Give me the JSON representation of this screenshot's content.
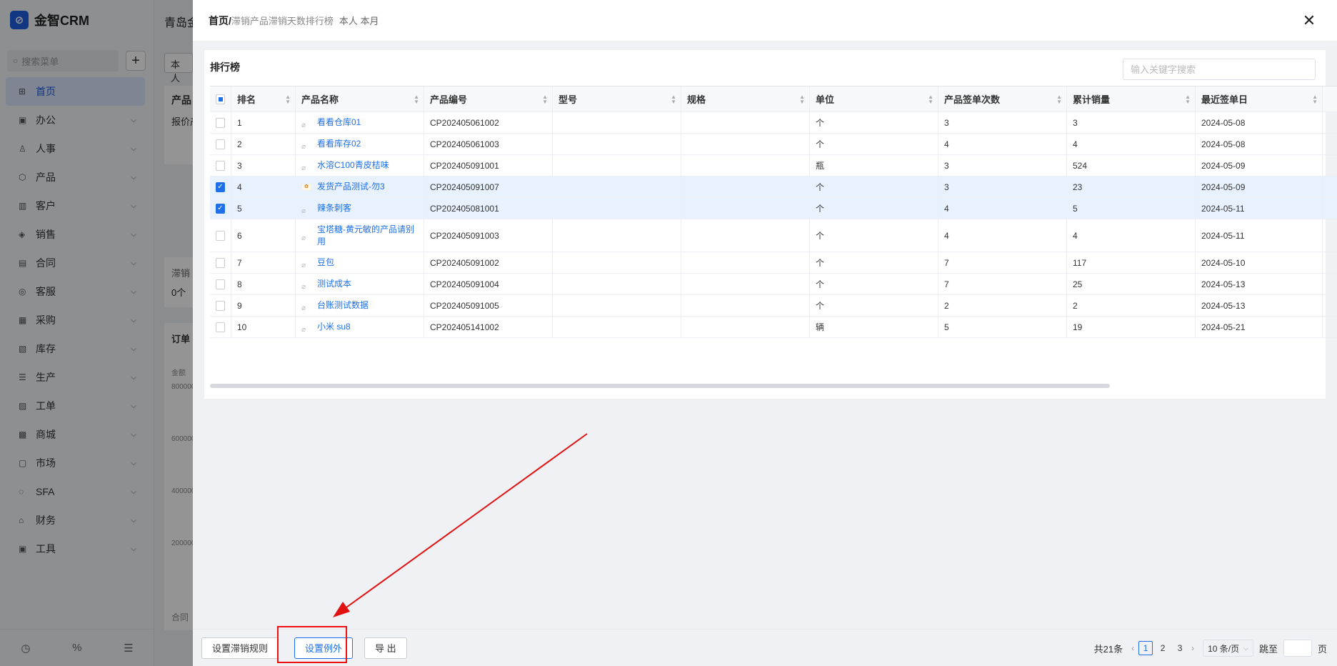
{
  "app": {
    "name": "金智CRM",
    "search_placeholder": "搜索菜单",
    "menu": [
      {
        "label": "首页",
        "icon": "home-icon",
        "active": true
      },
      {
        "label": "办公",
        "icon": "office-icon"
      },
      {
        "label": "人事",
        "icon": "people-icon"
      },
      {
        "label": "产品",
        "icon": "product-icon"
      },
      {
        "label": "客户",
        "icon": "customer-icon"
      },
      {
        "label": "销售",
        "icon": "sales-icon"
      },
      {
        "label": "合同",
        "icon": "contract-icon"
      },
      {
        "label": "客服",
        "icon": "service-icon"
      },
      {
        "label": "采购",
        "icon": "purchase-icon"
      },
      {
        "label": "库存",
        "icon": "inventory-icon"
      },
      {
        "label": "生产",
        "icon": "production-icon"
      },
      {
        "label": "工单",
        "icon": "workorder-icon"
      },
      {
        "label": "商城",
        "icon": "mall-icon"
      },
      {
        "label": "市场",
        "icon": "market-icon"
      },
      {
        "label": "SFA",
        "icon": "sfa-icon"
      },
      {
        "label": "财务",
        "icon": "finance-icon"
      },
      {
        "label": "工具",
        "icon": "tools-icon"
      }
    ],
    "bg_title": "青岛金",
    "bg_chip": "本人",
    "bg_text1": "产品",
    "bg_text2": "报价产",
    "bg_text3": "滞销",
    "bg_text4": "0个",
    "bg_text5": "订单",
    "bg_legend": "金额",
    "bg_ticks": [
      "800000",
      "600000",
      "400000",
      "200000"
    ],
    "bg_bottom": "合同"
  },
  "drawer": {
    "breadcrumb_home": "首页/",
    "breadcrumb_title": "滞销产品滞销天数排行榜",
    "breadcrumb_meta": "本人 本月",
    "panel_title": "排行榜",
    "search_placeholder": "输入关键字搜索",
    "columns": [
      "排名",
      "产品名称",
      "产品编号",
      "型号",
      "规格",
      "单位",
      "产品签单次数",
      "累计销量",
      "最近签单日"
    ],
    "rows": [
      {
        "rank": "1",
        "name": "看看仓库01",
        "code": "CP202405061002",
        "model": "",
        "spec": "",
        "unit": "个",
        "count": "3",
        "sales": "3",
        "date": "2024-05-08",
        "checked": false,
        "img": false
      },
      {
        "rank": "2",
        "name": "看看库存02",
        "code": "CP202405061003",
        "model": "",
        "spec": "",
        "unit": "个",
        "count": "4",
        "sales": "4",
        "date": "2024-05-08",
        "checked": false,
        "img": false
      },
      {
        "rank": "3",
        "name": "水溶C100青皮桔味",
        "code": "CP202405091001",
        "model": "",
        "spec": "",
        "unit": "瓶",
        "count": "3",
        "sales": "524",
        "date": "2024-05-09",
        "checked": false,
        "img": false
      },
      {
        "rank": "4",
        "name": "发货产品测试-勿3",
        "code": "CP202405091007",
        "model": "",
        "spec": "",
        "unit": "个",
        "count": "3",
        "sales": "23",
        "date": "2024-05-09",
        "checked": true,
        "img": true
      },
      {
        "rank": "5",
        "name": "辣条刺客",
        "code": "CP202405081001",
        "model": "",
        "spec": "",
        "unit": "个",
        "count": "4",
        "sales": "5",
        "date": "2024-05-11",
        "checked": true,
        "img": false
      },
      {
        "rank": "6",
        "name": "宝塔糖-黄元敏的产品请别用",
        "code": "CP202405091003",
        "model": "",
        "spec": "",
        "unit": "个",
        "count": "4",
        "sales": "4",
        "date": "2024-05-11",
        "checked": false,
        "img": false
      },
      {
        "rank": "7",
        "name": "豆包",
        "code": "CP202405091002",
        "model": "",
        "spec": "",
        "unit": "个",
        "count": "7",
        "sales": "117",
        "date": "2024-05-10",
        "checked": false,
        "img": false
      },
      {
        "rank": "8",
        "name": "测试成本",
        "code": "CP202405091004",
        "model": "",
        "spec": "",
        "unit": "个",
        "count": "7",
        "sales": "25",
        "date": "2024-05-13",
        "checked": false,
        "img": false
      },
      {
        "rank": "9",
        "name": "台账测试数据",
        "code": "CP202405091005",
        "model": "",
        "spec": "",
        "unit": "个",
        "count": "2",
        "sales": "2",
        "date": "2024-05-13",
        "checked": false,
        "img": false
      },
      {
        "rank": "10",
        "name": "小米 su8",
        "code": "CP202405141002",
        "model": "",
        "spec": "",
        "unit": "辆",
        "count": "5",
        "sales": "19",
        "date": "2024-05-21",
        "checked": false,
        "img": false
      }
    ],
    "buttons": {
      "set_rule": "设置滞销规则",
      "set_exception": "设置例外",
      "export": "导 出"
    },
    "pager": {
      "total": "共21条",
      "pages": [
        "1",
        "2",
        "3"
      ],
      "current": "1",
      "page_size": "10 条/页",
      "jump_label": "跳至",
      "page_label": "页"
    }
  },
  "colors": {
    "accent": "#1f6fe8",
    "highlight": "#e11111"
  }
}
